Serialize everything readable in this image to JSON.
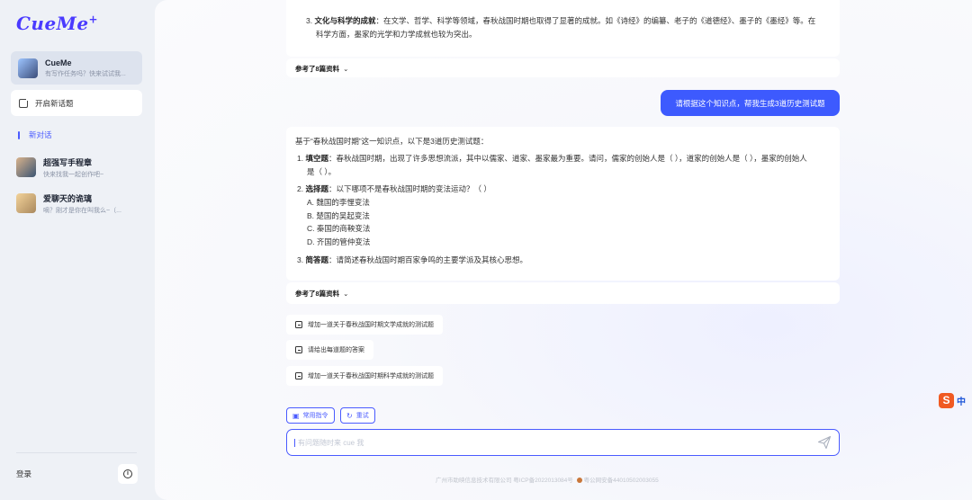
{
  "brand": {
    "logo": "CueMe",
    "logo_plus": "+"
  },
  "sidebar": {
    "bot": {
      "name": "CueMe",
      "subtitle": "有写作任务吗？快来试试我..."
    },
    "new_topic": "开启新话题",
    "new_chat": "新对话",
    "chats": [
      {
        "name": "超强写手程章",
        "preview": "快来找我一起创作吧~"
      },
      {
        "name": "爱聊天的诡璃",
        "preview": "嘀？刚才是你在叫我么~（..."
      }
    ],
    "login": "登录",
    "info_icon": "i"
  },
  "conversation": {
    "prev_answer": {
      "item_no": "3.",
      "item_title": "文化与科学的成就",
      "item_text": "：在文学、哲学、科学等领域，春秋战国时期也取得了显著的成就。如《诗经》的编纂、老子的《道德经》、墨子的《墨经》等。在",
      "item_text_cont": "科学方面，墨家的光学和力学成就也较为突出。"
    },
    "ref1": "参考了8篇资料",
    "user_message": "请根据这个知识点，帮我生成3道历史测试题",
    "answer": {
      "intro": "基于“春秋战国时期”这一知识点，以下是3道历史测试题：",
      "q1_no": "1.",
      "q1_title": "填空题",
      "q1_text": "：春秋战国时期，出现了许多思想流派，其中以儒家、道家、墨家最为重要。请问，儒家的创始人是（   ），道家的创始人是（   ），墨家的创始人",
      "q1_cont": "是（   ）。",
      "q2_no": "2.",
      "q2_title": "选择题",
      "q2_text": "：以下哪项不是春秋战国时期的变法运动？（   ）",
      "options": [
        "A. 魏国的李悝变法",
        "B. 楚国的吴起变法",
        "C. 秦国的商鞅变法",
        "D. 齐国的管仲变法"
      ],
      "q3_no": "3.",
      "q3_title": "简答题",
      "q3_text": "：请简述春秋战国时期百家争鸣的主要学派及其核心思想。"
    },
    "ref2": "参考了8篇资料",
    "suggestions": [
      "增加一道关于春秋战国时期文学成就的测试题",
      "请给出每道题的答案",
      "增加一道关于春秋战国时期科学成就的测试题"
    ]
  },
  "tools": {
    "commands": "常用指令",
    "retry": "重试"
  },
  "input": {
    "placeholder": "有问题随时来 cue 我",
    "value": ""
  },
  "footer": {
    "icp": "广州市助映信息技术有限公司 粤ICP备2022013084号",
    "police": "粤公网安备44010502003055"
  },
  "ime": {
    "logo": "S",
    "lang": "中"
  },
  "colors": {
    "accent": "#3d5afe",
    "brand": "#4a3aff"
  }
}
